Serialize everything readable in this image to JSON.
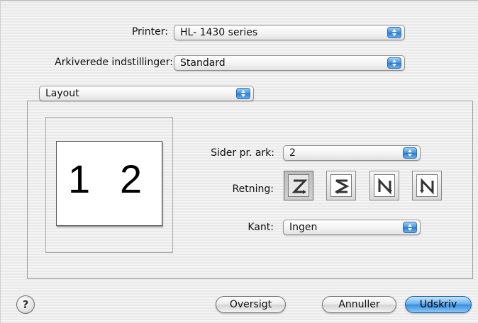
{
  "printer": {
    "label": "Printer:",
    "value": "HL- 1430 series"
  },
  "presets": {
    "label": "Arkiverede indstillinger:",
    "value": "Standard"
  },
  "panel": {
    "value": "Layout"
  },
  "preview": {
    "page_left": "1",
    "page_right": "2"
  },
  "layout": {
    "pages_label": "Sider pr. ark:",
    "pages_value": "2",
    "direction_label": "Retning:",
    "directions": [
      "z-order-icon",
      "s-order-icon",
      "n-reverse-order-icon",
      "n-order-icon"
    ],
    "selected_direction": 0,
    "border_label": "Kant:",
    "border_value": "Ingen"
  },
  "buttons": {
    "help": "?",
    "preview": "Oversigt",
    "cancel": "Annuller",
    "print": "Udskriv"
  },
  "colors": {
    "accent": "#3a8fe0"
  }
}
